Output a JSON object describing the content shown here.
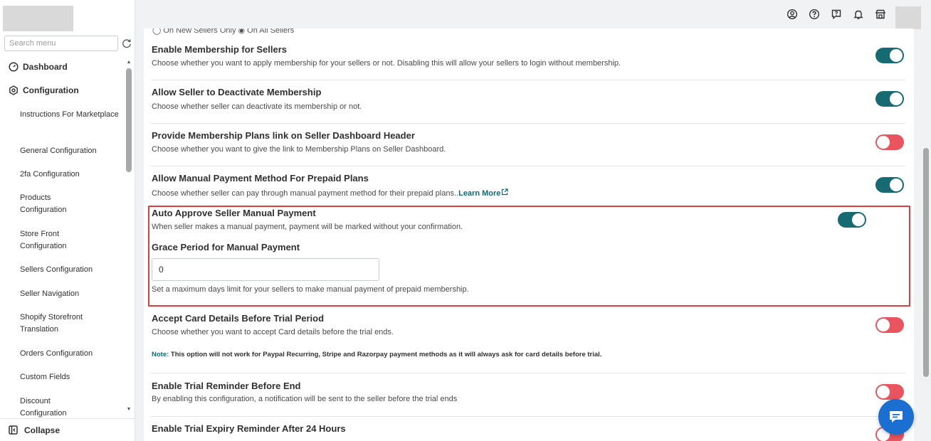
{
  "sidebar": {
    "search_placeholder": "Search menu",
    "top_items": [
      {
        "label": "Dashboard",
        "icon": "dashboard-icon"
      },
      {
        "label": "Configuration",
        "icon": "settings-icon"
      }
    ],
    "sub_items": [
      {
        "label": "Instructions For Marketplace"
      },
      {
        "label": "General Configuration"
      },
      {
        "label": "2fa Configuration"
      },
      {
        "label": "Products Configuration"
      },
      {
        "label": "Store Front Configuration"
      },
      {
        "label": "Sellers Configuration"
      },
      {
        "label": "Seller Navigation"
      },
      {
        "label": "Shopify Storefront Translation"
      },
      {
        "label": "Orders Configuration"
      },
      {
        "label": "Custom Fields"
      },
      {
        "label": "Discount Configuration"
      }
    ],
    "collapse_label": "Collapse"
  },
  "topbar": {
    "icons": [
      "user-circle-icon",
      "help-icon",
      "feedback-icon",
      "bell-icon",
      "store-icon"
    ]
  },
  "main": {
    "radio_row": "◯ On New Sellers Only    ◉ On All Sellers",
    "settings": [
      {
        "title": "Enable Membership for Sellers",
        "desc": "Choose whether you want to apply membership for your sellers or not. Disabling this will allow your sellers to login without membership.",
        "state": "on"
      },
      {
        "title": "Allow Seller to Deactivate Membership",
        "desc": "Choose whether seller can deactivate its membership or not.",
        "state": "on"
      },
      {
        "title": "Provide Membership Plans link on Seller Dashboard Header",
        "desc": "Choose whether you want to give the link to Membership Plans on Seller Dashboard.",
        "state": "off"
      },
      {
        "title": "Allow Manual Payment Method For Prepaid Plans",
        "desc": "Choose whether seller can pay through manual payment method for their prepaid plans..",
        "link": "Learn More",
        "state": "on"
      },
      {
        "title": "Auto Approve Seller Manual Payment",
        "desc": "When seller makes a manual payment, payment will be marked without your confirmation.",
        "state": "on"
      },
      {
        "title": "Accept Card Details Before Trial Period",
        "desc": "Choose whether you want to accept Card details before the trial ends.",
        "state": "off"
      },
      {
        "title": "Enable Trial Reminder Before End",
        "desc": "By enabling this configuration, a notification will be sent to the seller before the trial ends",
        "state": "off"
      },
      {
        "title": "Enable Trial Expiry Reminder After 24 Hours",
        "desc": "",
        "state": "off"
      }
    ],
    "grace": {
      "title": "Grace Period for Manual Payment",
      "value": "0",
      "help": "Set a maximum days limit for your sellers to make manual payment of prepaid membership."
    },
    "note": {
      "label": "Note:",
      "text": " This option will not work for Paypal Recurring, Stripe and Razorpay payment methods as it will always ask for card details before trial."
    }
  },
  "colors": {
    "toggle_on": "#166a72",
    "toggle_off": "#e9545e",
    "highlight": "#e03e3e",
    "chat": "#1a6fd1"
  }
}
